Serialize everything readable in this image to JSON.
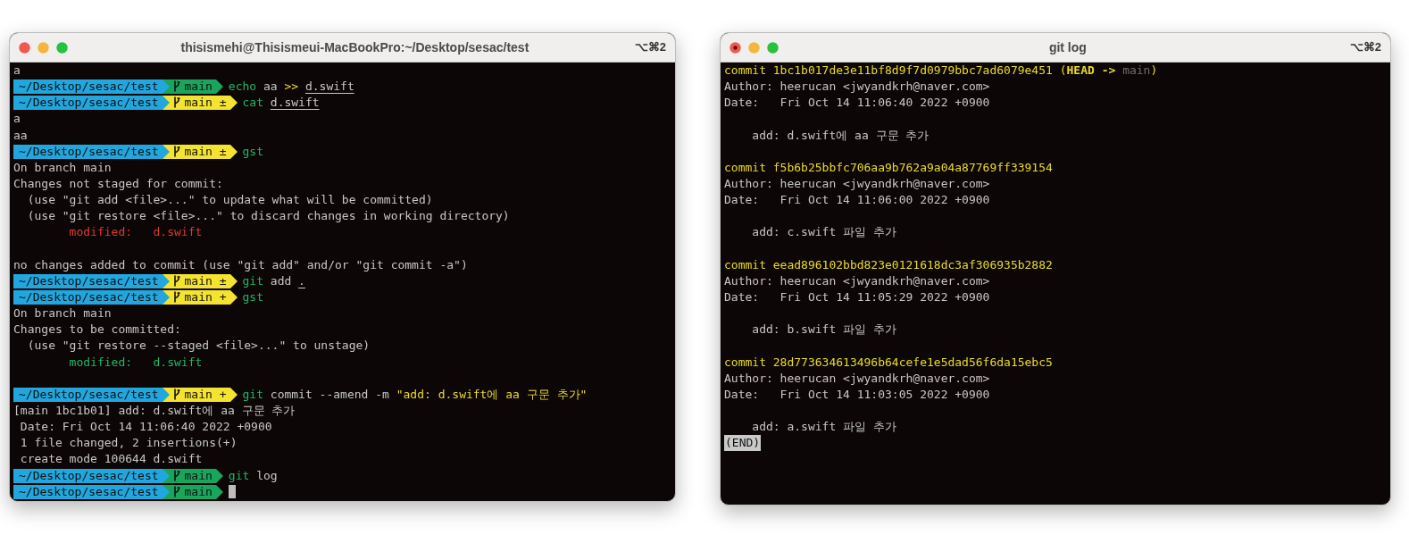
{
  "windows": [
    {
      "title": "thisismehi@Thisismeui-MacBookPro:~/Desktop/sesac/test",
      "shortcut": "⌥⌘2",
      "focused": false,
      "lines": [
        {
          "kind": "output",
          "segments": [
            {
              "text": "a",
              "kind": "text"
            }
          ]
        },
        {
          "kind": "prompt",
          "path": "~/Desktop/sesac/test",
          "branch": "main",
          "dirty": false,
          "command": [
            {
              "text": "echo",
              "kind": "program"
            },
            {
              "text": "aa",
              "kind": "argument"
            },
            {
              "text": ">>",
              "kind": "operator"
            },
            {
              "text": "d.swift",
              "kind": "path"
            }
          ]
        },
        {
          "kind": "prompt",
          "path": "~/Desktop/sesac/test",
          "branch": "main",
          "mark": "±",
          "dirty": true,
          "command": [
            {
              "text": "cat",
              "kind": "program"
            },
            {
              "text": "d.swift",
              "kind": "path"
            }
          ]
        },
        {
          "kind": "output",
          "segments": [
            {
              "text": "a",
              "kind": "text"
            }
          ]
        },
        {
          "kind": "output",
          "segments": [
            {
              "text": "aa",
              "kind": "text"
            }
          ]
        },
        {
          "kind": "prompt",
          "path": "~/Desktop/sesac/test",
          "branch": "main",
          "mark": "±",
          "dirty": true,
          "command": [
            {
              "text": "gst",
              "kind": "program"
            }
          ]
        },
        {
          "kind": "output",
          "segments": [
            {
              "text": "On branch main",
              "kind": "text"
            }
          ]
        },
        {
          "kind": "output",
          "segments": [
            {
              "text": "Changes not staged for commit:",
              "kind": "text"
            }
          ]
        },
        {
          "kind": "output",
          "segments": [
            {
              "text": "  (use \"git add <file>...\" to update what will be committed)",
              "kind": "text"
            }
          ]
        },
        {
          "kind": "output",
          "segments": [
            {
              "text": "  (use \"git restore <file>...\" to discard changes in working directory)",
              "kind": "text"
            }
          ]
        },
        {
          "kind": "output",
          "segments": [
            {
              "text": "        modified:   d.swift",
              "kind": "unstaged"
            }
          ]
        },
        {
          "kind": "blank"
        },
        {
          "kind": "output",
          "segments": [
            {
              "text": "no changes added to commit (use \"git add\" and/or \"git commit -a\")",
              "kind": "text"
            }
          ]
        },
        {
          "kind": "prompt",
          "path": "~/Desktop/sesac/test",
          "branch": "main",
          "mark": "±",
          "dirty": true,
          "command": [
            {
              "text": "git",
              "kind": "program"
            },
            {
              "text": "add",
              "kind": "argument"
            },
            {
              "text": ".",
              "kind": "path"
            }
          ]
        },
        {
          "kind": "prompt",
          "path": "~/Desktop/sesac/test",
          "branch": "main",
          "mark": "+",
          "dirty": true,
          "command": [
            {
              "text": "gst",
              "kind": "program"
            }
          ]
        },
        {
          "kind": "output",
          "segments": [
            {
              "text": "On branch main",
              "kind": "text"
            }
          ]
        },
        {
          "kind": "output",
          "segments": [
            {
              "text": "Changes to be committed:",
              "kind": "text"
            }
          ]
        },
        {
          "kind": "output",
          "segments": [
            {
              "text": "  (use \"git restore --staged <file>...\" to unstage)",
              "kind": "text"
            }
          ]
        },
        {
          "kind": "output",
          "segments": [
            {
              "text": "        modified:   d.swift",
              "kind": "staged"
            }
          ]
        },
        {
          "kind": "blank"
        },
        {
          "kind": "prompt",
          "path": "~/Desktop/sesac/test",
          "branch": "main",
          "mark": "+",
          "dirty": true,
          "command": [
            {
              "text": "git",
              "kind": "program"
            },
            {
              "text": "commit --amend -m",
              "kind": "argument"
            },
            {
              "text": "\"add: d.swift에 aa 구문 추가\"",
              "kind": "string"
            }
          ]
        },
        {
          "kind": "output",
          "segments": [
            {
              "text": "[main 1bc1b01] add: d.swift에 aa 구문 추가",
              "kind": "text"
            }
          ]
        },
        {
          "kind": "output",
          "segments": [
            {
              "text": " Date: Fri Oct 14 11:06:40 2022 +0900",
              "kind": "text"
            }
          ]
        },
        {
          "kind": "output",
          "segments": [
            {
              "text": " 1 file changed, 2 insertions(+)",
              "kind": "text"
            }
          ]
        },
        {
          "kind": "output",
          "segments": [
            {
              "text": " create mode 100644 d.swift",
              "kind": "text"
            }
          ]
        },
        {
          "kind": "prompt",
          "path": "~/Desktop/sesac/test",
          "branch": "main",
          "dirty": false,
          "command": [
            {
              "text": "git",
              "kind": "program"
            },
            {
              "text": "log",
              "kind": "argument"
            }
          ]
        },
        {
          "kind": "prompt",
          "path": "~/Desktop/sesac/test",
          "branch": "main",
          "dirty": false,
          "cursor": true
        }
      ]
    },
    {
      "title": "git log",
      "shortcut": "⌥⌘2",
      "focused": true,
      "lines": [
        {
          "kind": "output",
          "segments": [
            {
              "text": "commit 1bc1b017de3e11bf8d9f7d0979bbc7ad6079e451 (",
              "kind": "commit"
            },
            {
              "text": "HEAD -> ",
              "kind": "head"
            },
            {
              "text": "main",
              "kind": "ref"
            },
            {
              "text": ")",
              "kind": "commit"
            }
          ]
        },
        {
          "kind": "output",
          "segments": [
            {
              "text": "Author: heerucan <jwyandkrh@naver.com>",
              "kind": "text"
            }
          ]
        },
        {
          "kind": "output",
          "segments": [
            {
              "text": "Date:   Fri Oct 14 11:06:40 2022 +0900",
              "kind": "text"
            }
          ]
        },
        {
          "kind": "blank"
        },
        {
          "kind": "output",
          "segments": [
            {
              "text": "    add: d.swift에 aa 구문 추가",
              "kind": "text"
            }
          ]
        },
        {
          "kind": "blank"
        },
        {
          "kind": "output",
          "segments": [
            {
              "text": "commit f5b6b25bbfc706aa9b762a9a04a87769ff339154",
              "kind": "commit"
            }
          ]
        },
        {
          "kind": "output",
          "segments": [
            {
              "text": "Author: heerucan <jwyandkrh@naver.com>",
              "kind": "text"
            }
          ]
        },
        {
          "kind": "output",
          "segments": [
            {
              "text": "Date:   Fri Oct 14 11:06:00 2022 +0900",
              "kind": "text"
            }
          ]
        },
        {
          "kind": "blank"
        },
        {
          "kind": "output",
          "segments": [
            {
              "text": "    add: c.swift 파일 추가",
              "kind": "text"
            }
          ]
        },
        {
          "kind": "blank"
        },
        {
          "kind": "output",
          "segments": [
            {
              "text": "commit eead896102bbd823e0121618dc3af306935b2882",
              "kind": "commit"
            }
          ]
        },
        {
          "kind": "output",
          "segments": [
            {
              "text": "Author: heerucan <jwyandkrh@naver.com>",
              "kind": "text"
            }
          ]
        },
        {
          "kind": "output",
          "segments": [
            {
              "text": "Date:   Fri Oct 14 11:05:29 2022 +0900",
              "kind": "text"
            }
          ]
        },
        {
          "kind": "blank"
        },
        {
          "kind": "output",
          "segments": [
            {
              "text": "    add: b.swift 파일 추가",
              "kind": "text"
            }
          ]
        },
        {
          "kind": "blank"
        },
        {
          "kind": "output",
          "segments": [
            {
              "text": "commit 28d773634613496b64cefe1e5dad56f6da15ebc5",
              "kind": "commit"
            }
          ]
        },
        {
          "kind": "output",
          "segments": [
            {
              "text": "Author: heerucan <jwyandkrh@naver.com>",
              "kind": "text"
            }
          ]
        },
        {
          "kind": "output",
          "segments": [
            {
              "text": "Date:   Fri Oct 14 11:03:05 2022 +0900",
              "kind": "text"
            }
          ]
        },
        {
          "kind": "blank"
        },
        {
          "kind": "output",
          "segments": [
            {
              "text": "    add: a.swift 파일 추가",
              "kind": "text"
            }
          ]
        },
        {
          "kind": "pager_end",
          "text": "(END)"
        }
      ]
    }
  ]
}
